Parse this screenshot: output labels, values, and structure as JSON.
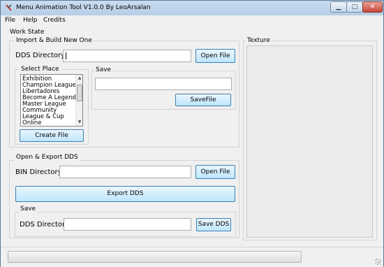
{
  "window": {
    "title": "Menu Animation Tool  V1.0.0 By LeoArsalan"
  },
  "menu": {
    "file": "File",
    "help": "Help",
    "credits": "Credits"
  },
  "work_state": {
    "label": "Work State"
  },
  "import_build": {
    "group_label": "Import & Build New One",
    "dds_directory_label": "DDS Directory:",
    "dds_directory_value": "",
    "open_file_label": "Open File",
    "select_place_label": "Select Place",
    "places": [
      "Exhibition",
      "Champion League",
      "Libertadores",
      "Become A Legend",
      "Master League",
      "Community",
      "League & Cup",
      "Online"
    ],
    "create_file_label": "Create File",
    "save_label": "Save",
    "save_value": "",
    "save_file_label": "SaveFile"
  },
  "open_export": {
    "group_label": "Open & Export DDS",
    "bin_directory_label": "BIN Directory:",
    "bin_directory_value": "",
    "open_file_label": "Open File",
    "export_dds_label": "Export DDS",
    "save_label": "Save",
    "dds_directory_label": "DDS Directory:",
    "dds_directory_value": "",
    "save_dds_label": "Save DDS"
  },
  "texture": {
    "label": "Texture"
  },
  "status": {
    "progress": 0
  }
}
